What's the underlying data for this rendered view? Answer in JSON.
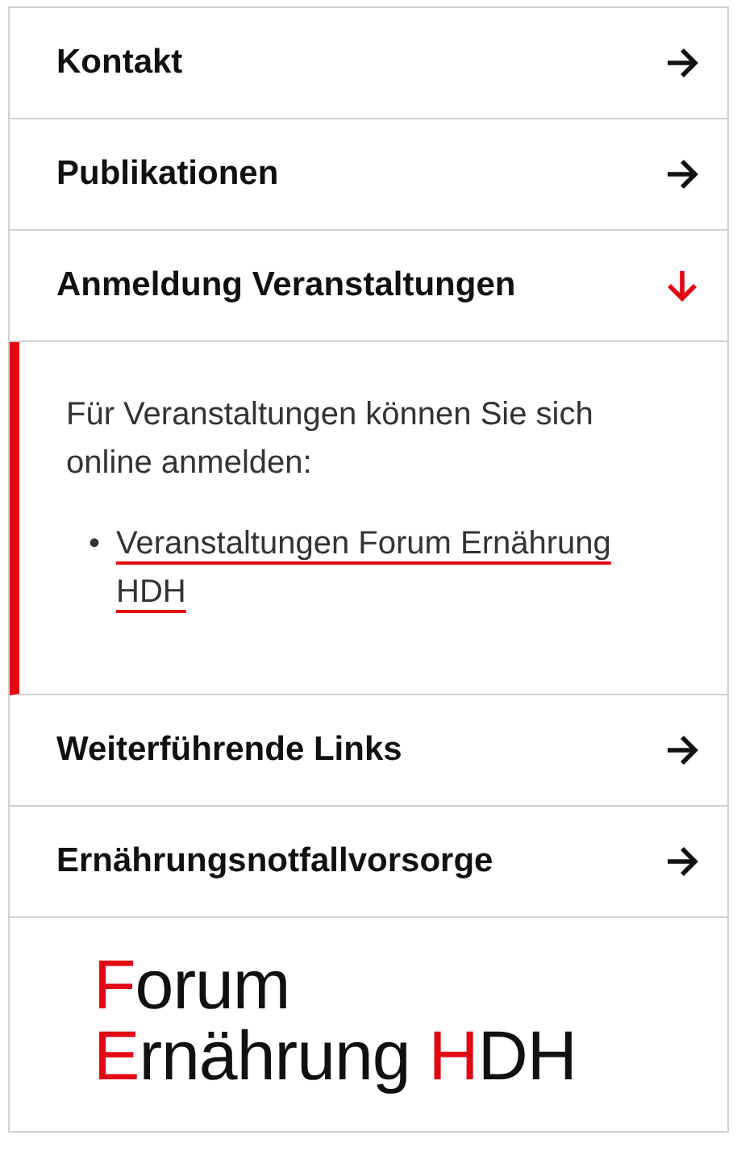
{
  "accordion": [
    {
      "title": "Kontakt",
      "expanded": false
    },
    {
      "title": "Publikationen",
      "expanded": false
    },
    {
      "title": "Anmeldung Veranstaltungen",
      "expanded": true,
      "text": "Für Veranstaltungen können Sie sich online anmelden:",
      "links": [
        {
          "bullet": "•",
          "text": "Veranstaltungen Forum Ernährung HDH"
        }
      ]
    },
    {
      "title": "Weiterführende Links",
      "expanded": false
    },
    {
      "title": "Ernährungsnotfallvorsorge",
      "expanded": false
    }
  ],
  "logo": {
    "lines": [
      [
        {
          "text": "F",
          "accent": true
        },
        {
          "text": "orum",
          "accent": false
        }
      ],
      [
        {
          "text": "E",
          "accent": true
        },
        {
          "text": "rnährung ",
          "accent": false
        },
        {
          "text": "H",
          "accent": true
        },
        {
          "text": "DH",
          "accent": false
        }
      ]
    ]
  }
}
